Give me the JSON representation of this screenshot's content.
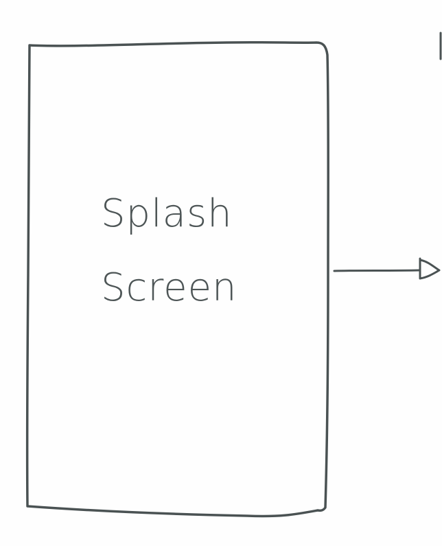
{
  "diagram": {
    "screen_box": {
      "label_line1": "Splash",
      "label_line2": "Screen"
    }
  },
  "colors": {
    "background": "#fefefe",
    "stroke": "#4a5253",
    "text": "#4d5556"
  }
}
